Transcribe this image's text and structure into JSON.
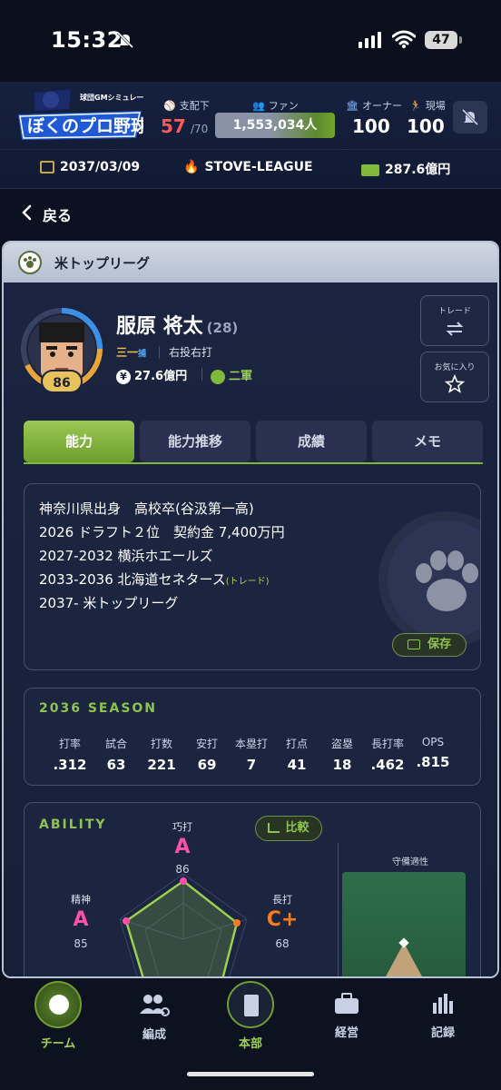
{
  "status": {
    "time": "15:32",
    "battery": "47"
  },
  "header": {
    "logo_small": "球団GMシミュレーション",
    "logo_main": "ぼくのプロ野球",
    "control_label": "支配下",
    "control_value": "57",
    "control_max": "/70",
    "fans_label": "ファン",
    "fans_value": "1,553,034人",
    "owner_label": "オーナー",
    "owner_value": "100",
    "field_label": "現場",
    "field_value": "100",
    "date": "2037/03/09",
    "phase": "STOVE-LEAGUE",
    "money": "287.6億円"
  },
  "nav": {
    "back_label": "戻る"
  },
  "league": {
    "name": "米トップリーグ"
  },
  "player": {
    "name": "服原 将太",
    "age": "(28)",
    "position_main": "三一",
    "position_sub": "捕",
    "handedness": "右投右打",
    "salary": "27.6億円",
    "team": "二軍",
    "overall": "86"
  },
  "buttons": {
    "trade": "トレード",
    "favorite": "お気に入り",
    "save": "保存",
    "compare": "比較"
  },
  "tabs": [
    "能力",
    "能力推移",
    "成績",
    "メモ"
  ],
  "bio": {
    "line1": "神奈川県出身　高校卒(谷汲第一高)",
    "line2": "2026 ドラフト２位　契約金 7,400万円",
    "line3": "2027-2032 横浜ホエールズ",
    "line4": "2033-2036 北海道セネタース",
    "line4_note": "(トレード)",
    "line5": "2037- 米トップリーグ"
  },
  "season": {
    "title": "2036 SEASON",
    "headers": [
      "打率",
      "試合",
      "打数",
      "安打",
      "本塁打",
      "打点",
      "盗塁",
      "長打率",
      "OPS"
    ],
    "values": [
      ".312",
      "63",
      "221",
      "69",
      "7",
      "41",
      "18",
      ".462",
      ".815"
    ]
  },
  "ability": {
    "title": "ABILITY",
    "contact_label": "巧打",
    "contact_grade": "A",
    "contact_value": "86",
    "mental_label": "精神",
    "mental_grade": "A",
    "mental_value": "85",
    "power_label": "長打",
    "power_grade": "C+",
    "power_value": "68",
    "field_title": "守備適性"
  },
  "bottom_nav": [
    "チーム",
    "編成",
    "本部",
    "経営",
    "記録"
  ],
  "colors": {
    "accent_green": "#8fc24f",
    "grade_a": "#ff4fa8",
    "grade_c": "#ff7a1a",
    "red": "#ff5a5a"
  }
}
